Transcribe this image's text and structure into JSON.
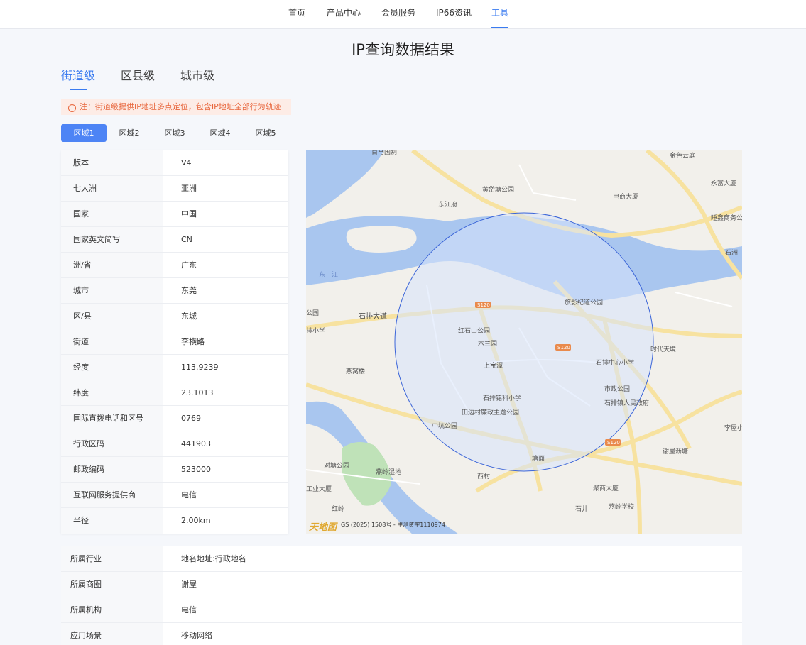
{
  "nav": {
    "items": [
      "首页",
      "产品中心",
      "会员服务",
      "IP66资讯",
      "工具"
    ],
    "active_index": 4
  },
  "page_title": "IP查询数据结果",
  "level_tabs": [
    "街道级",
    "区县级",
    "城市级"
  ],
  "notice": {
    "icon": "info-icon",
    "text": "注：街道级提供IP地址多点定位，包含IP地址全部行为轨迹"
  },
  "region_tabs": [
    "区域1",
    "区域2",
    "区域3",
    "区域4",
    "区域5"
  ],
  "info_rows": [
    {
      "label": "版本",
      "value": "V4"
    },
    {
      "label": "七大洲",
      "value": "亚洲"
    },
    {
      "label": "国家",
      "value": "中国"
    },
    {
      "label": "国家英文简写",
      "value": "CN"
    },
    {
      "label": "洲/省",
      "value": "广东"
    },
    {
      "label": "城市",
      "value": "东莞"
    },
    {
      "label": "区/县",
      "value": "东城"
    },
    {
      "label": "街道",
      "value": "李横路"
    },
    {
      "label": "经度",
      "value": "113.9239"
    },
    {
      "label": "纬度",
      "value": "23.1013"
    },
    {
      "label": "国际直拨电话和区号",
      "value": "0769"
    },
    {
      "label": "行政区码",
      "value": "441903"
    },
    {
      "label": "邮政编码",
      "value": "523000"
    },
    {
      "label": "互联网服务提供商",
      "value": "电信"
    },
    {
      "label": "半径",
      "value": "2.00km"
    }
  ],
  "map": {
    "labels": {
      "river": "东　江",
      "road_main": "石排大道",
      "s120": "S120",
      "huangtang": "黄岱塘公园",
      "dongjiangfu": "东江府",
      "dianshang": "电商大厦",
      "yongfu": "永富大厦",
      "shengtai": "睡鑫商务公",
      "shizhou": "石洲",
      "lvyou": "旅影纪道公园",
      "hongshishan": "红石山公园",
      "mulan": "木兰园",
      "shangbaotan": "上宝潭",
      "shipaizhongxin": "石排中心小学",
      "shidai": "时代天境",
      "shizheng": "市政公园",
      "shipaizhen": "石排镇人民政府",
      "yanwo": "燕窝楼",
      "shipaiming": "石排铭科小学",
      "tianbian": "田边村廉政主题公园",
      "zhonghang": "中坑公园",
      "tangmian": "塘面",
      "xiewu": "谢屋沥塘",
      "xicun": "西村",
      "jiyi": "聚商大厦",
      "shijing": "石井",
      "yanling_school": "燕岭学校",
      "duitang": "对塘公园",
      "yanling_wet": "燕岭湿地",
      "gongye": "工业大厦",
      "hongling": "红岭",
      "gongyuan": "公园",
      "xiaoxue": "排小学",
      "liwu": "李屋小",
      "jinse": "金色云庭",
      "top_cut": "百马国别",
      "copyright": "GS (2025) 1508号 - 甲测资字1110974",
      "logo": "天地图"
    }
  },
  "bottom_rows": [
    {
      "label": "所属行业",
      "value": "地名地址:行政地名"
    },
    {
      "label": "所属商圈",
      "value": "谢屋"
    },
    {
      "label": "所属机构",
      "value": "电信"
    },
    {
      "label": "应用场景",
      "value": "移动网络"
    }
  ]
}
